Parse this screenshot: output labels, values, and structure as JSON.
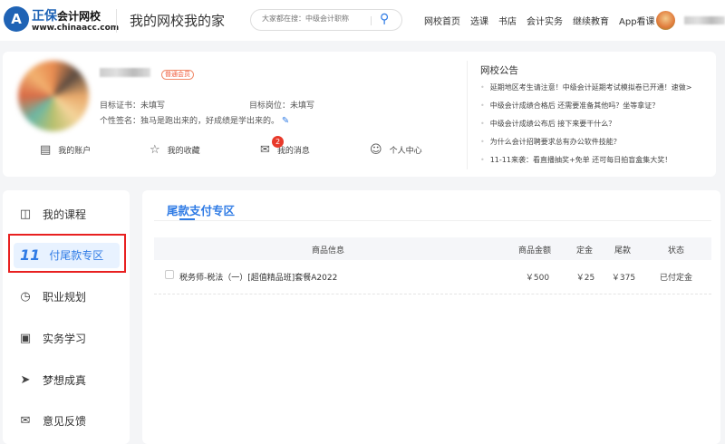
{
  "header": {
    "logo_text": "正保",
    "logo_sub": "会计网校",
    "logo_url": "www.chinaacc.com",
    "site_title": "我的网校我的家",
    "search_placeholder": "大家都在搜：中级会计职称",
    "nav": [
      "网校首页",
      "选课",
      "书店",
      "会计实务",
      "继续教育",
      "App看课"
    ]
  },
  "profile": {
    "member_badge": "普通会员",
    "target_cert_label": "目标证书：",
    "target_cert": "未填写",
    "target_job_label": "目标岗位：",
    "target_job": "未填写",
    "signature_label": "个性签名：",
    "signature": "独马是跑出来的，好成绩是学出来的。",
    "actions": [
      {
        "label": "我的账户",
        "icon": "wallet-icon"
      },
      {
        "label": "我的收藏",
        "icon": "star-icon"
      },
      {
        "label": "我的消息",
        "icon": "mail-icon",
        "badge": "2"
      },
      {
        "label": "个人中心",
        "icon": "user-icon"
      }
    ]
  },
  "announcements": {
    "title": "网校公告",
    "items": [
      "延期地区考生请注意！中级会计延期考试模拟卷已开通！速做>",
      "中级会计成绩合格后 还需要准备其他吗？坐等拿证？",
      "中级会计成绩公布后 接下来要干什么？",
      "为什么会计招聘要求总有办公软件技能？",
      "11-11来袭：看直播抽奖+免单 还可每日拍盲盒集大奖！"
    ]
  },
  "sidebar": {
    "items": [
      {
        "label": "我的课程",
        "icon": "book-icon"
      },
      {
        "label": "付尾款专区",
        "icon": "eleven-icon",
        "glyph": "11",
        "active": true
      },
      {
        "label": "职业规划",
        "icon": "chart-circle-icon"
      },
      {
        "label": "实务学习",
        "icon": "monitor-icon"
      },
      {
        "label": "梦想成真",
        "icon": "paper-plane-icon"
      },
      {
        "label": "意见反馈",
        "icon": "envelope-icon"
      }
    ]
  },
  "main": {
    "tab": "尾款支付专区",
    "columns": [
      "商品信息",
      "商品金额",
      "定金",
      "尾款",
      "状态"
    ],
    "rows": [
      {
        "name": "税务师-税法（一）[超值精品班]套餐A2022",
        "price": "￥500",
        "deposit": "￥25",
        "balance": "￥375",
        "status": "已付定金"
      }
    ]
  },
  "colors": {
    "accent": "#2f7be5",
    "highlight_border": "#e82020"
  }
}
